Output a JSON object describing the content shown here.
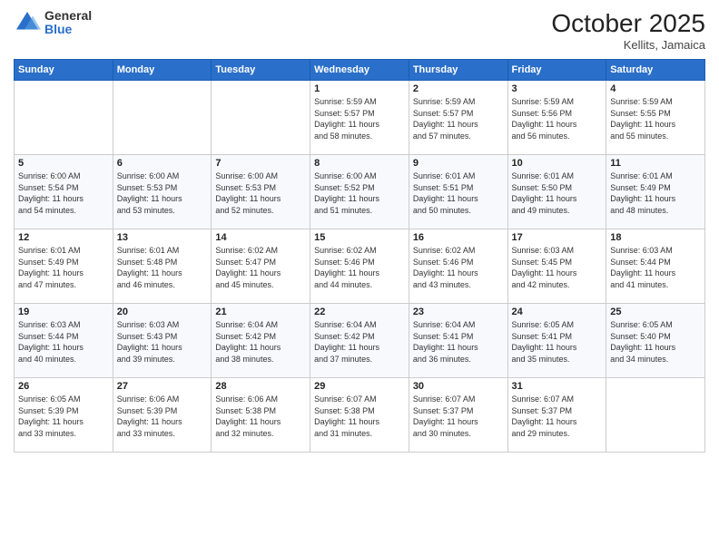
{
  "header": {
    "logo_general": "General",
    "logo_blue": "Blue",
    "month_title": "October 2025",
    "location": "Kellits, Jamaica"
  },
  "days_of_week": [
    "Sunday",
    "Monday",
    "Tuesday",
    "Wednesday",
    "Thursday",
    "Friday",
    "Saturday"
  ],
  "weeks": [
    [
      {
        "day": "",
        "info": ""
      },
      {
        "day": "",
        "info": ""
      },
      {
        "day": "",
        "info": ""
      },
      {
        "day": "1",
        "info": "Sunrise: 5:59 AM\nSunset: 5:57 PM\nDaylight: 11 hours\nand 58 minutes."
      },
      {
        "day": "2",
        "info": "Sunrise: 5:59 AM\nSunset: 5:57 PM\nDaylight: 11 hours\nand 57 minutes."
      },
      {
        "day": "3",
        "info": "Sunrise: 5:59 AM\nSunset: 5:56 PM\nDaylight: 11 hours\nand 56 minutes."
      },
      {
        "day": "4",
        "info": "Sunrise: 5:59 AM\nSunset: 5:55 PM\nDaylight: 11 hours\nand 55 minutes."
      }
    ],
    [
      {
        "day": "5",
        "info": "Sunrise: 6:00 AM\nSunset: 5:54 PM\nDaylight: 11 hours\nand 54 minutes."
      },
      {
        "day": "6",
        "info": "Sunrise: 6:00 AM\nSunset: 5:53 PM\nDaylight: 11 hours\nand 53 minutes."
      },
      {
        "day": "7",
        "info": "Sunrise: 6:00 AM\nSunset: 5:53 PM\nDaylight: 11 hours\nand 52 minutes."
      },
      {
        "day": "8",
        "info": "Sunrise: 6:00 AM\nSunset: 5:52 PM\nDaylight: 11 hours\nand 51 minutes."
      },
      {
        "day": "9",
        "info": "Sunrise: 6:01 AM\nSunset: 5:51 PM\nDaylight: 11 hours\nand 50 minutes."
      },
      {
        "day": "10",
        "info": "Sunrise: 6:01 AM\nSunset: 5:50 PM\nDaylight: 11 hours\nand 49 minutes."
      },
      {
        "day": "11",
        "info": "Sunrise: 6:01 AM\nSunset: 5:49 PM\nDaylight: 11 hours\nand 48 minutes."
      }
    ],
    [
      {
        "day": "12",
        "info": "Sunrise: 6:01 AM\nSunset: 5:49 PM\nDaylight: 11 hours\nand 47 minutes."
      },
      {
        "day": "13",
        "info": "Sunrise: 6:01 AM\nSunset: 5:48 PM\nDaylight: 11 hours\nand 46 minutes."
      },
      {
        "day": "14",
        "info": "Sunrise: 6:02 AM\nSunset: 5:47 PM\nDaylight: 11 hours\nand 45 minutes."
      },
      {
        "day": "15",
        "info": "Sunrise: 6:02 AM\nSunset: 5:46 PM\nDaylight: 11 hours\nand 44 minutes."
      },
      {
        "day": "16",
        "info": "Sunrise: 6:02 AM\nSunset: 5:46 PM\nDaylight: 11 hours\nand 43 minutes."
      },
      {
        "day": "17",
        "info": "Sunrise: 6:03 AM\nSunset: 5:45 PM\nDaylight: 11 hours\nand 42 minutes."
      },
      {
        "day": "18",
        "info": "Sunrise: 6:03 AM\nSunset: 5:44 PM\nDaylight: 11 hours\nand 41 minutes."
      }
    ],
    [
      {
        "day": "19",
        "info": "Sunrise: 6:03 AM\nSunset: 5:44 PM\nDaylight: 11 hours\nand 40 minutes."
      },
      {
        "day": "20",
        "info": "Sunrise: 6:03 AM\nSunset: 5:43 PM\nDaylight: 11 hours\nand 39 minutes."
      },
      {
        "day": "21",
        "info": "Sunrise: 6:04 AM\nSunset: 5:42 PM\nDaylight: 11 hours\nand 38 minutes."
      },
      {
        "day": "22",
        "info": "Sunrise: 6:04 AM\nSunset: 5:42 PM\nDaylight: 11 hours\nand 37 minutes."
      },
      {
        "day": "23",
        "info": "Sunrise: 6:04 AM\nSunset: 5:41 PM\nDaylight: 11 hours\nand 36 minutes."
      },
      {
        "day": "24",
        "info": "Sunrise: 6:05 AM\nSunset: 5:41 PM\nDaylight: 11 hours\nand 35 minutes."
      },
      {
        "day": "25",
        "info": "Sunrise: 6:05 AM\nSunset: 5:40 PM\nDaylight: 11 hours\nand 34 minutes."
      }
    ],
    [
      {
        "day": "26",
        "info": "Sunrise: 6:05 AM\nSunset: 5:39 PM\nDaylight: 11 hours\nand 33 minutes."
      },
      {
        "day": "27",
        "info": "Sunrise: 6:06 AM\nSunset: 5:39 PM\nDaylight: 11 hours\nand 33 minutes."
      },
      {
        "day": "28",
        "info": "Sunrise: 6:06 AM\nSunset: 5:38 PM\nDaylight: 11 hours\nand 32 minutes."
      },
      {
        "day": "29",
        "info": "Sunrise: 6:07 AM\nSunset: 5:38 PM\nDaylight: 11 hours\nand 31 minutes."
      },
      {
        "day": "30",
        "info": "Sunrise: 6:07 AM\nSunset: 5:37 PM\nDaylight: 11 hours\nand 30 minutes."
      },
      {
        "day": "31",
        "info": "Sunrise: 6:07 AM\nSunset: 5:37 PM\nDaylight: 11 hours\nand 29 minutes."
      },
      {
        "day": "",
        "info": ""
      }
    ]
  ]
}
